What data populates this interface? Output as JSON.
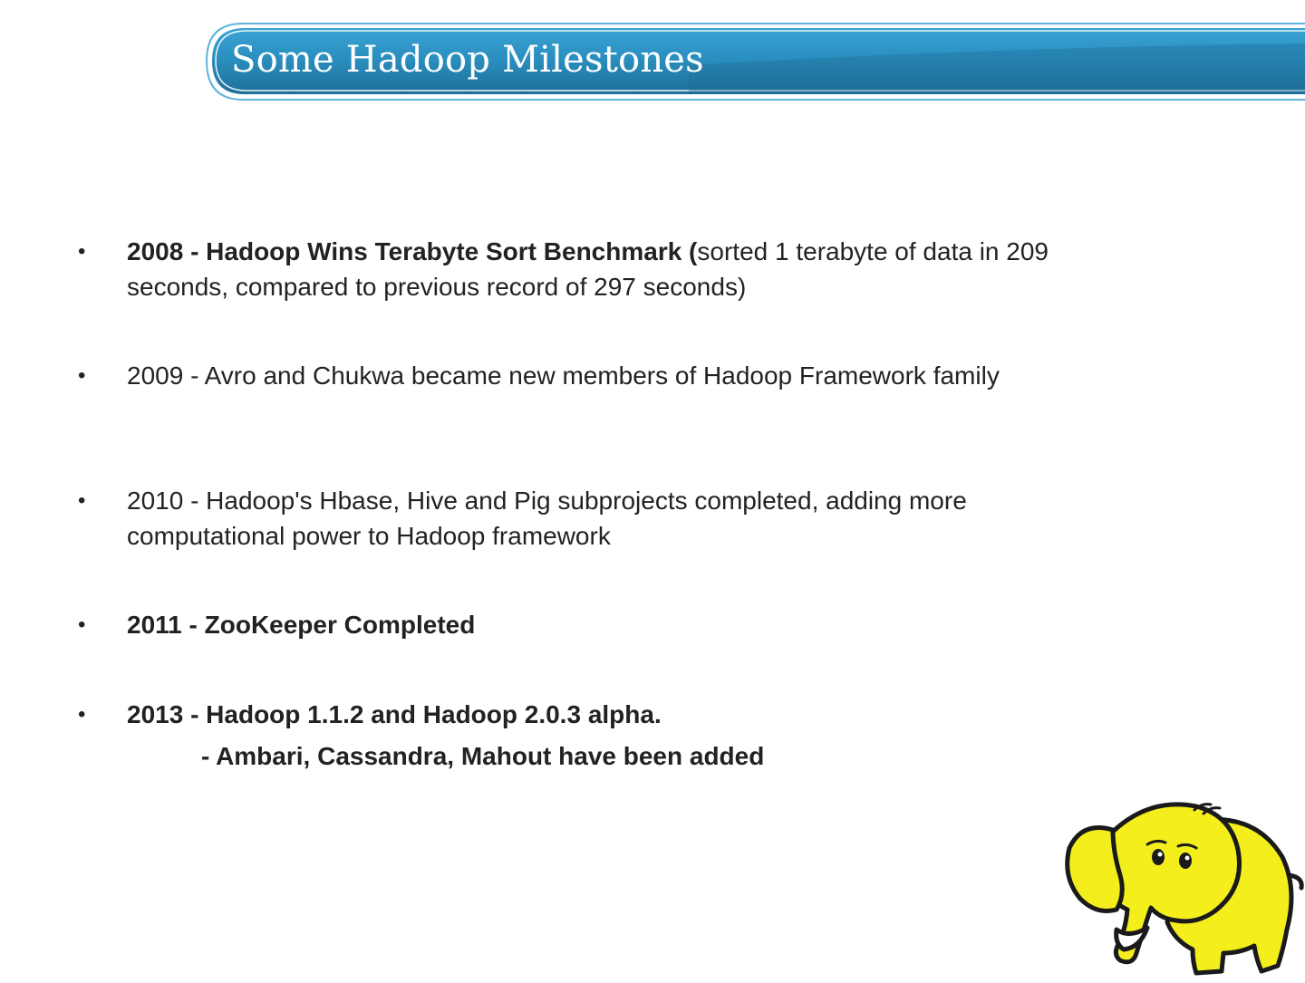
{
  "slide": {
    "title": "Some Hadoop Milestones"
  },
  "milestones": [
    {
      "bold": "2008 - Hadoop Wins Terabyte Sort  Benchmark (",
      "normal": "sorted 1 terabyte of data in 209 seconds, compared to previous record of 297 seconds)"
    },
    {
      "bold": "",
      "normal": "2009 - Avro and Chukwa became new members of Hadoop Framework family"
    },
    {
      "bold": "",
      "normal": "2010 - Hadoop's Hbase, Hive and Pig subprojects completed, adding more computational power to Hadoop framework"
    },
    {
      "bold": "2011 - ZooKeeper Completed",
      "normal": ""
    },
    {
      "bold": "2013 - Hadoop 1.1.2 and Hadoop 2.0.3 alpha.",
      "normal": "",
      "sub": "- Ambari, Cassandra, Mahout have been added"
    }
  ],
  "bullet_symbol": "•",
  "icons": {
    "mascot": "hadoop-elephant-icon"
  },
  "colors": {
    "banner_blue": "#2a8fc0",
    "banner_dark": "#1f6f98",
    "mascot_yellow": "#f4ee1c"
  }
}
